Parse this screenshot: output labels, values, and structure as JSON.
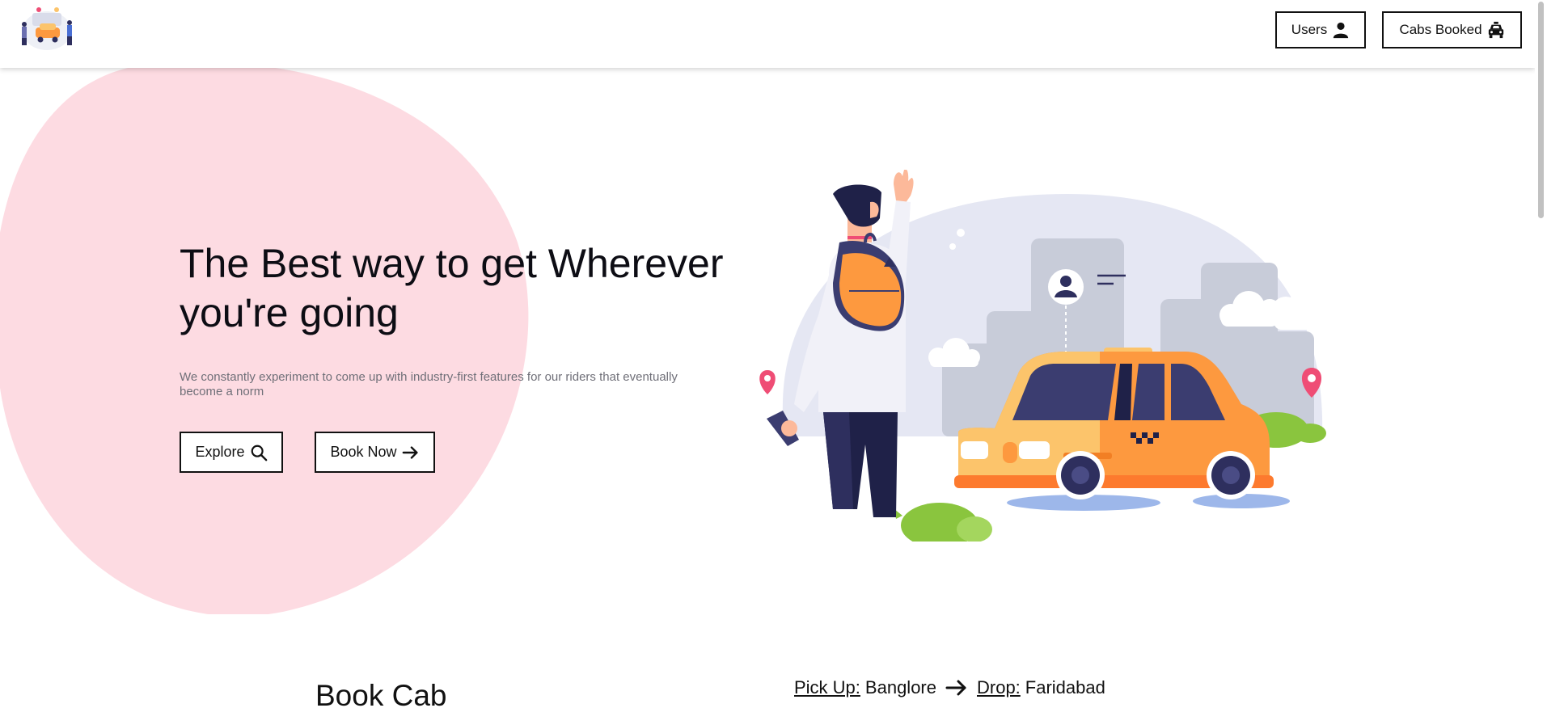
{
  "nav": {
    "users_label": "Users",
    "cabs_label": "Cabs Booked",
    "users_icon": "user-icon",
    "cabs_icon": "taxi-icon"
  },
  "hero": {
    "title": "The Best way to get Wherever you're going",
    "subtitle": "We constantly experiment to come up with industry-first features for our riders that eventually become a norm",
    "explore_label": "Explore",
    "book_label": "Book Now",
    "explore_icon": "search-icon",
    "book_icon": "arrow-right-icon"
  },
  "booking": {
    "title": "Book Cab",
    "pickup_label": "Pick Up:",
    "pickup_value": "Banglore",
    "drop_label": "Drop:",
    "drop_value": "Faridabad"
  },
  "colors": {
    "blob": "#fddbe2",
    "taxi": "#fd993f",
    "taxi_light": "#fcc46b",
    "navy": "#2e2f5e",
    "pin": "#ef4d75",
    "bush": "#8ac53e"
  }
}
